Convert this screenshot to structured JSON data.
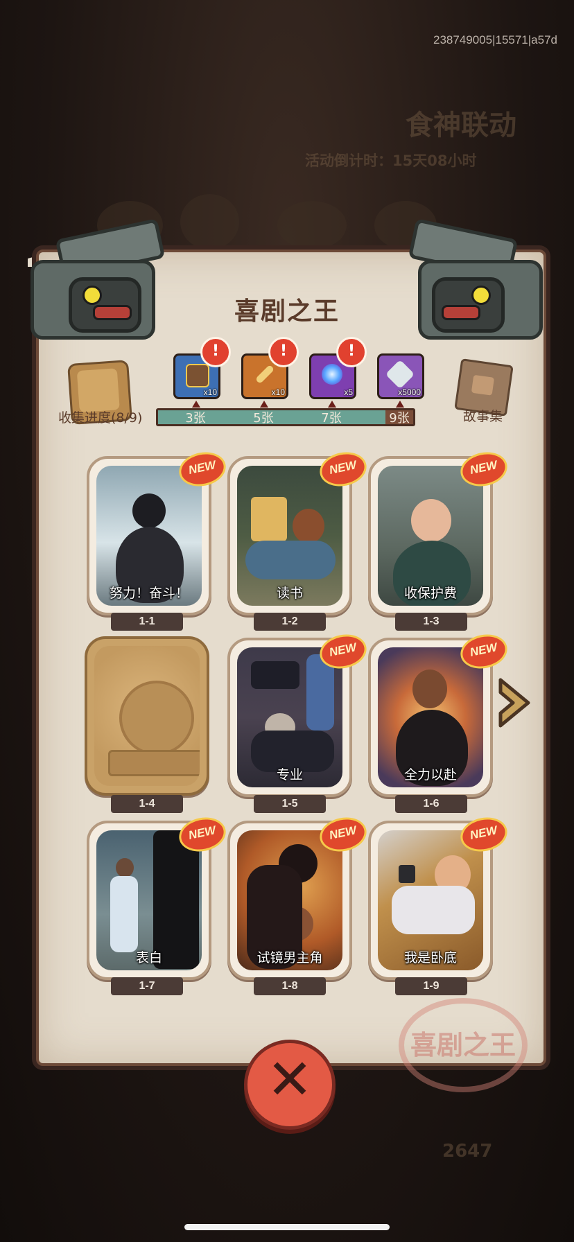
{
  "debug_id": "238749005|15571|a57d",
  "background": {
    "event_title": "食神联动",
    "countdown": "活动倒计时：15天08小时",
    "faded_number": "2647"
  },
  "panel": {
    "title": "喜剧之王",
    "collect_label": "收集进度(8/9)",
    "collect_progress": 0.89,
    "story_label": "故事集",
    "seal_text": "喜剧之王"
  },
  "milestones": [
    {
      "label": "3张",
      "reward": "chest-icon",
      "qty": "x10",
      "color": "#3d6fb4",
      "alert": "!"
    },
    {
      "label": "5张",
      "reward": "quill-icon",
      "qty": "x10",
      "color": "#c9732c",
      "alert": "!"
    },
    {
      "label": "7张",
      "reward": "orb-icon",
      "qty": "x5",
      "color": "#7e3fb0",
      "alert": "!"
    },
    {
      "label": "9张",
      "reward": "crystal-icon",
      "qty": "x5000",
      "color": "#8a55b8"
    }
  ],
  "cards": [
    {
      "id": "1-1",
      "title": "努力！奋斗！",
      "new": "NEW"
    },
    {
      "id": "1-2",
      "title": "读书",
      "new": "NEW"
    },
    {
      "id": "1-3",
      "title": "收保护费",
      "new": "NEW"
    },
    {
      "id": "1-4",
      "title": "",
      "locked": true
    },
    {
      "id": "1-5",
      "title": "专业",
      "new": "NEW"
    },
    {
      "id": "1-6",
      "title": "全力以赴",
      "new": "NEW"
    },
    {
      "id": "1-7",
      "title": "表白",
      "new": "NEW"
    },
    {
      "id": "1-8",
      "title": "试镜男主角",
      "new": "NEW"
    },
    {
      "id": "1-9",
      "title": "我是卧底",
      "new": "NEW"
    }
  ],
  "close_icon": "close-icon",
  "next_icon": "next-page-arrow-icon"
}
